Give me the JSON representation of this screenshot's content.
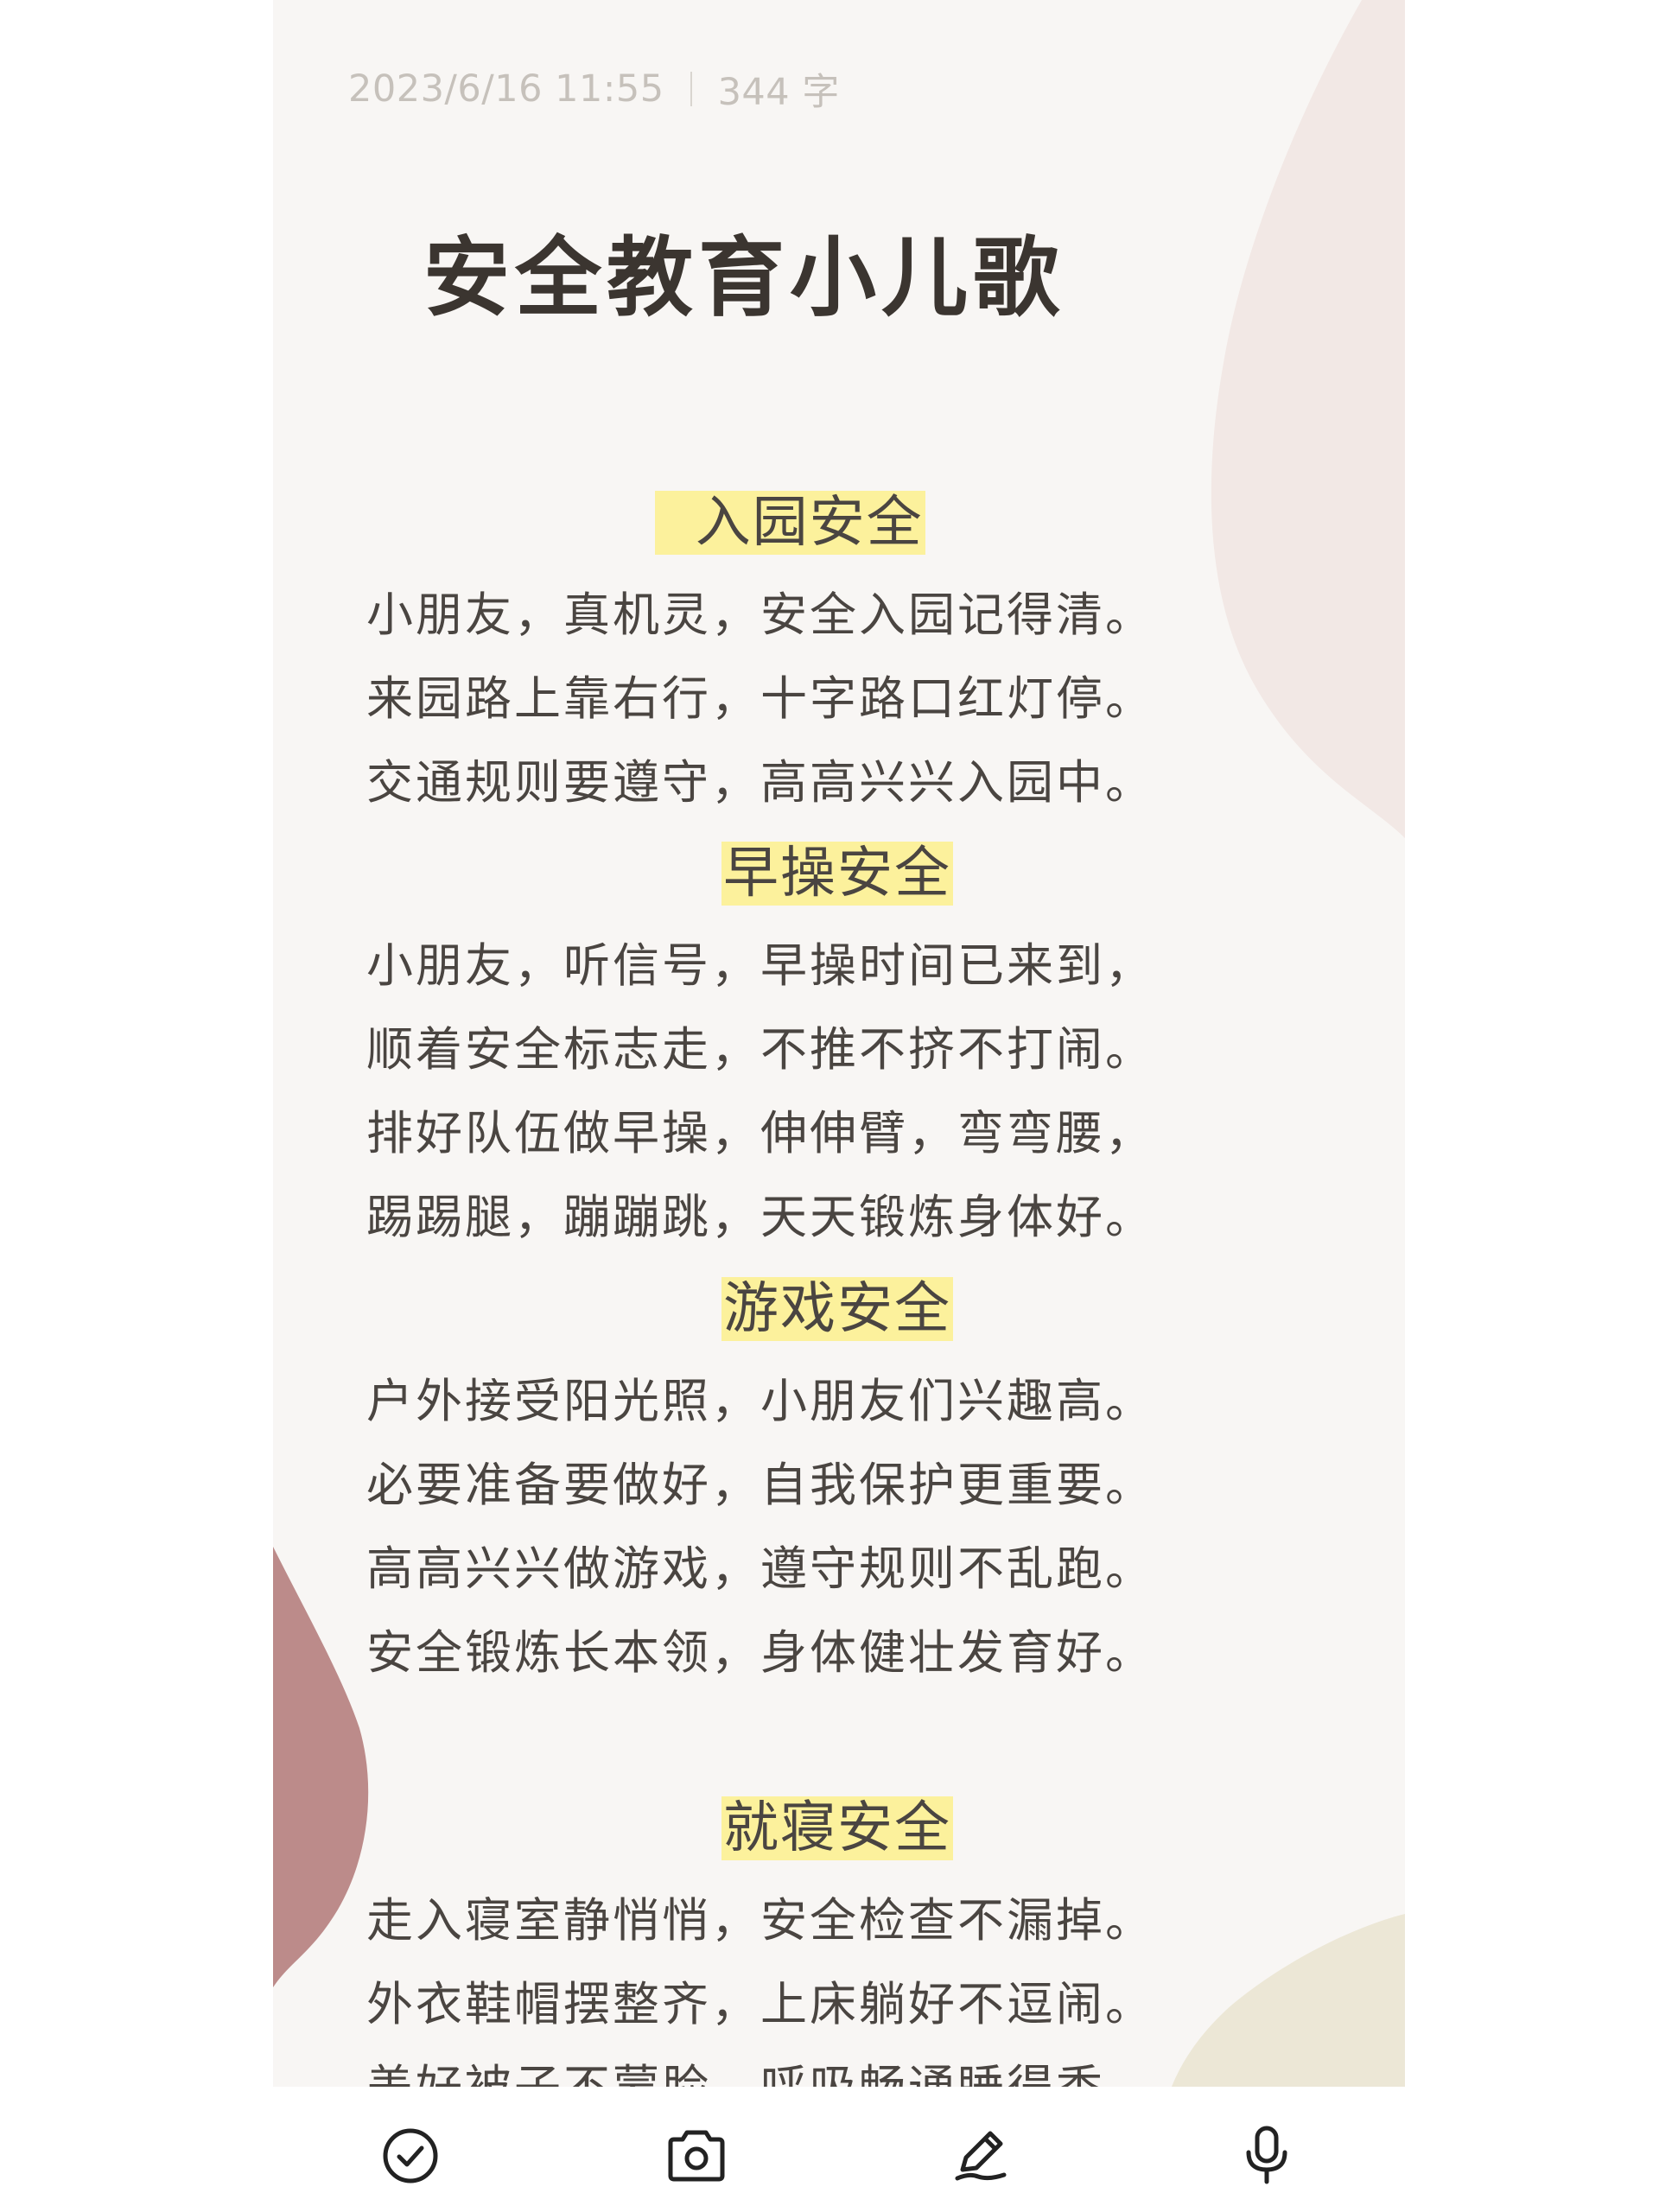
{
  "note": {
    "date": "2023/6/16 11:55",
    "word_count": "344 字",
    "title": "安全教育小儿歌",
    "sections": [
      {
        "heading": "入园安全",
        "lines": [
          "小朋友，真机灵，安全入园记得清。",
          "来园路上靠右行，十字路口红灯停。",
          "交通规则要遵守，高高兴兴入园中。"
        ]
      },
      {
        "heading": "早操安全",
        "lines": [
          "小朋友，听信号，早操时间已来到，",
          "顺着安全标志走，不推不挤不打闹。",
          "排好队伍做早操，伸伸臂，弯弯腰，",
          "踢踢腿，蹦蹦跳，天天锻炼身体好。"
        ]
      },
      {
        "heading": "游戏安全",
        "lines": [
          "户外接受阳光照，小朋友们兴趣高。",
          "必要准备要做好，自我保护更重要。",
          "高高兴兴做游戏，遵守规则不乱跑。",
          "安全锻炼长本领，身体健壮发育好。"
        ]
      },
      {
        "heading": "就寝安全",
        "lines": [
          "走入寝室静悄悄，安全检查不漏掉。",
          "外衣鞋帽摆整齐，上床躺好不逗闹。",
          "盖好被子不蒙脸，呼吸畅通睡得香。"
        ]
      }
    ]
  },
  "toolbar": {
    "icons": [
      "checklist-icon",
      "camera-icon",
      "pen-icon",
      "microphone-icon"
    ]
  },
  "colors": {
    "paper": "#f8f6f4",
    "highlight": "#fcf19c",
    "shape_pink": "#f2e8e5",
    "shape_rose": "#bc8b8a",
    "shape_sand": "#ece7d6"
  }
}
